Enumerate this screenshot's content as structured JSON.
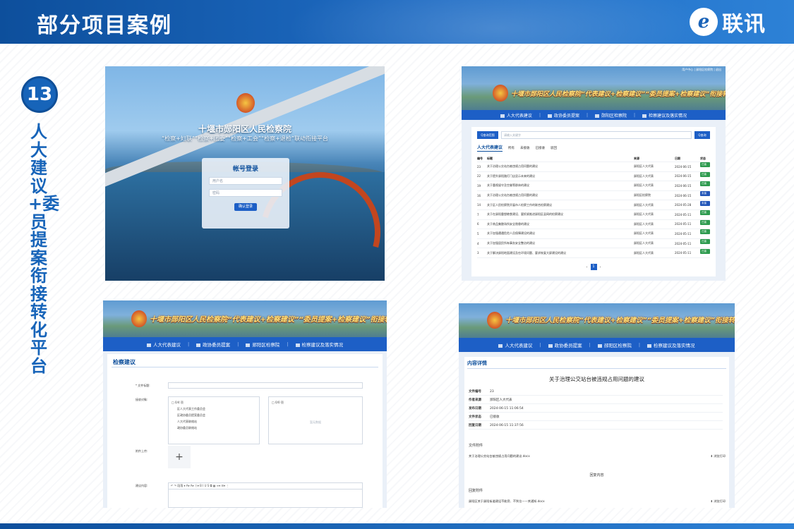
{
  "header": {
    "title": "部分项目案例",
    "logo_mark": "e",
    "logo_text": "联讯"
  },
  "case": {
    "number": "13",
    "vertical_title": "人大建议+委员提案衔接转化平台"
  },
  "login_shot": {
    "system_title": "十堰市郧阳区人民检察院",
    "system_subtitle": "“检察+妇联”“检察+团委”“检察+工会”“检察+退检”联动衔接平台",
    "login_title": "帐号登录",
    "username_placeholder": "用户名",
    "password_placeholder": "密码",
    "submit": "确认登录"
  },
  "site": {
    "banner_title": "十堰市郧阳区人民检察院“代表建议+检察建议”“委员提案+检察建议”衔接转化平台",
    "nav": [
      "人大代表建议",
      "政协委员提案",
      "郧阳区检察院",
      "检察建议及落实情况"
    ],
    "top_links": "用户中心 | 郧阳区检察院 | 退出"
  },
  "list_shot": {
    "search_select": "Q查询范围",
    "search_placeholder": "请输入关键字",
    "search_button": "Q查询",
    "tab_main": "人大代表建议",
    "tabs": [
      "所有",
      "未接收",
      "已接收",
      "驳回"
    ],
    "columns": [
      "编号",
      "标题",
      "来源",
      "日期",
      "状态"
    ],
    "rows": [
      {
        "no": "23",
        "title": "关于治理公交站台被违规占用问题的建议",
        "src": "郧阳区人大代表",
        "date": "2024-06-15",
        "status": "已接收",
        "color": "green"
      },
      {
        "no": "22",
        "title": "关于提升郧阳路灯门店显示未来的建议",
        "src": "郧阳区人大代表",
        "date": "2024-06-15",
        "status": "已接收",
        "color": "green"
      },
      {
        "no": "19",
        "title": "关于重视留守及空巢等群体的建议",
        "src": "郧阳区人大代表",
        "date": "2024-06-15",
        "status": "已接收",
        "color": "green"
      },
      {
        "no": "16",
        "title": "关于治理公交站台被违规占用问题的建议",
        "src": "郧阳区检察院",
        "date": "2024-06-15",
        "status": "未接收",
        "color": "blue"
      },
      {
        "no": "14",
        "title": "关于区人民检察院开展市人检察工作的联合检察建议",
        "src": "郧阳区人大代表",
        "date": "2024-05-28",
        "status": "未接收",
        "color": "blue"
      },
      {
        "no": "7",
        "title": "关于在郧阳重塑粮食建设、要抓紧推进郧阳区县网的检察建议",
        "src": "郧阳区人大代表",
        "date": "2024-05-11",
        "status": "已接收",
        "color": "green"
      },
      {
        "no": "6",
        "title": "关于商品集散场所安全隐患的建议",
        "src": "郧阳区人大代表",
        "date": "2024-05-11",
        "status": "已接收",
        "color": "green"
      },
      {
        "no": "5",
        "title": "关于加强遭遇危险人员保障建设的建议",
        "src": "郧阳区人大代表",
        "date": "2024-05-11",
        "status": "已接收",
        "color": "green"
      },
      {
        "no": "4",
        "title": "关于加强居民所有事务安全整治的建议",
        "src": "郧阳区人大代表",
        "date": "2024-05-11",
        "status": "已接收",
        "color": "green"
      },
      {
        "no": "3",
        "title": "关于解决郧阳地面建设及在环境问题、要求恢复大屏建设的建议",
        "src": "郧阳区人大代表",
        "date": "2024-05-11",
        "status": "已接收",
        "color": "green"
      }
    ],
    "page_current": "1",
    "page_prev": "‹",
    "page_next": "›"
  },
  "form_shot": {
    "panel_title": "检察建议",
    "label_title": "* 文件标题:",
    "label_recipients": "接收对象:",
    "left_list_title": "□ 0/4 项",
    "left_list": [
      "区人大代表工作委员会",
      "区政协委员提案委员会",
      "人大代表联络站",
      "政协委员联络站"
    ],
    "right_list_title": "□ 0/0 项",
    "right_empty": "暂无数据",
    "label_upload": "附件上传:",
    "upload_plus": "+",
    "label_content": "建议内容:",
    "toolbar": "↶ ↷ 段落 ▾ A▾ A▾ ⓐ▾ B I U S ⧉ ▦ ≡▾ ☰▾ ⋮"
  },
  "detail_shot": {
    "panel_title": "内容详情",
    "doc_title": "关于治理公交站台被违规占用问题的建议",
    "meta": [
      {
        "k": "文件编号",
        "v": "23"
      },
      {
        "k": "作者来源",
        "v": "郧阳区人大代表"
      },
      {
        "k": "发布日期",
        "v": "2024-06-15 11:06:54"
      },
      {
        "k": "文件状态",
        "v": "已接收"
      },
      {
        "k": "回复日期",
        "v": "2024-06-15 11:37:56"
      }
    ],
    "attachments_title": "文件附件",
    "attachment": "关于治理公交站台被违规占用问题的建议.docx",
    "download": "⬇ 浏览打印",
    "reply_title": "回复内容",
    "reply_att_title": "回复附件",
    "reply_attachment": "郧阳区关于郧阳街道建设不能旁、不到位——关通知.docx",
    "reply_download": "⬇ 浏览打印"
  }
}
